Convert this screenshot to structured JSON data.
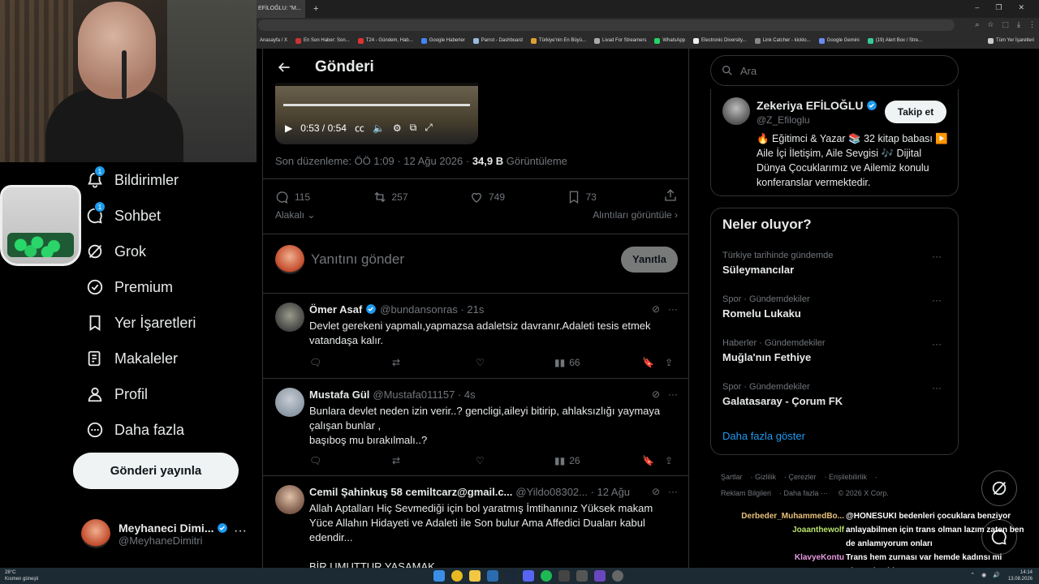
{
  "browser": {
    "tab_title": "EFİLOĞLU: \"M...",
    "bookmarks": [
      "Anasayfa / X",
      "En Son Haber: Son...",
      "T24 - Gündem, Hab...",
      "Google Haberler",
      "Parrot - Dashboard",
      "Türkiye'nin En Büyü...",
      "Livad For Streamers",
      "WhatsApp",
      "Electronic Diversity...",
      "Link Catcher - kicklo...",
      "Google Gemini",
      "(19) Alert Box / Stre..."
    ],
    "bookmarks_all": "Tüm Yer İşaretleri"
  },
  "nav": {
    "items": [
      {
        "label": "Bildirimler",
        "icon": "bell-icon",
        "badge": "1"
      },
      {
        "label": "Sohbet",
        "icon": "chat-icon",
        "badge": "1"
      },
      {
        "label": "Grok",
        "icon": "grok-icon"
      },
      {
        "label": "Premium",
        "icon": "verified-icon"
      },
      {
        "label": "Yer İşaretleri",
        "icon": "bookmark-icon"
      },
      {
        "label": "Makaleler",
        "icon": "article-icon"
      },
      {
        "label": "Profil",
        "icon": "person-icon"
      },
      {
        "label": "Daha fazla",
        "icon": "more-circle-icon"
      }
    ],
    "post_button": "Gönderi yayınla",
    "account": {
      "name": "Meyhaneci Dimi...",
      "handle": "@MeyhaneDimitri"
    }
  },
  "post": {
    "header_title": "Gönderi",
    "video_time": "0:53 / 0:54",
    "meta_prefix": "Son düzenleme: ÖÖ 1:09 · 12 Ağu 2026 · ",
    "views_count": "34,9 B",
    "views_label": "Görüntüleme",
    "stats": {
      "replies": "115",
      "reposts": "257",
      "likes": "749",
      "bookmarks": "73"
    },
    "related_label": "Alakalı",
    "quotes_label": "Alıntıları görüntüle",
    "reply_placeholder": "Yanıtını gönder",
    "reply_button": "Yanıtla"
  },
  "replies": [
    {
      "name": "Ömer Asaf",
      "verified": true,
      "handle": "@bundansonras · 21s",
      "text": "Devlet gerekeni yapmalı,yapmazsa  adaletsiz davranır.Adaleti tesis etmek vatandaşa kalır.",
      "views": "66"
    },
    {
      "name": "Mustafa Gül",
      "verified": false,
      "handle": "@Mustafa011157 · 4s",
      "text": "Bunlara devlet neden izin verir..? gencligi,aileyi bitirip,  ahlaksızlığı yaymaya çalışan bunlar ,\nbaşıboş mu bırakılmalı..?",
      "views": "26"
    },
    {
      "name": "Cemil Şahinkuş 58 cemiltcarz@gmail.c...",
      "verified": false,
      "handle": "@Yildo08302... · 12 Ağu",
      "text": "Allah Aptalları Hiç Sevmediği için bol yaratmış İmtihanınız Yüksek makam Yüce Allahın Hidayeti ve Adaleti ile Son bulur Ama Affedici Duaları kabul edendir...\n\nBİR UMUTTUR YAŞAMAK",
      "views": ""
    }
  ],
  "sidebar": {
    "search_placeholder": "Ara",
    "profile": {
      "name": "Zekeriya EFİLOĞLU",
      "handle": "@Z_Efiloglu",
      "follow": "Takip et",
      "bio": "🔥 Eğitimci & Yazar 📚 32 kitap babası ▶️ Aile İçi İletişim, Aile Sevgisi 🎶 Dijital Dünya Çocuklarımız ve Ailemiz konulu konferanslar vermektedir."
    },
    "trends_title": "Neler oluyor?",
    "trends": [
      {
        "meta": "Türkiye tarihinde gündemde",
        "name": "Süleymancılar"
      },
      {
        "meta": "Spor · Gündemdekiler",
        "name": "Romelu Lukaku"
      },
      {
        "meta": "Haberler · Gündemdekiler",
        "name": "Muğla'nın Fethiye"
      },
      {
        "meta": "Spor · Gündemdekiler",
        "name": "Galatasaray - Çorum FK"
      }
    ],
    "show_more": "Daha fazla göster",
    "footer": [
      "Şartlar",
      "Gizlilik",
      "Çerezler",
      "Erişilebilirlik",
      "Reklam Bilgileri",
      "Daha fazla ···",
      "© 2026 X Corp."
    ]
  },
  "chat": [
    {
      "user": "Derbeder_MuhammedBo...",
      "color": "#e8c07a",
      "msg": "@HONESUKI bedenleri çocuklara benziyor"
    },
    {
      "user": "Joaanthewolf",
      "color": "#b9e26b",
      "msg": "anlayabilmen için trans olman lazım zaten ben de anlamıyorum onları"
    },
    {
      "user": "KlavyeKontu",
      "color": "#e79ae0",
      "msg": "Trans hem zurnası var hemde kadınsı mi oluyordu abi"
    }
  ],
  "taskbar": {
    "weather_temp": "28°C",
    "weather_desc": "Kısmen güneşli",
    "time": "14:14",
    "date": "13.08.2026"
  },
  "colors": {
    "accent": "#1d9bf0",
    "border": "#2f3336",
    "muted": "#71767b"
  }
}
